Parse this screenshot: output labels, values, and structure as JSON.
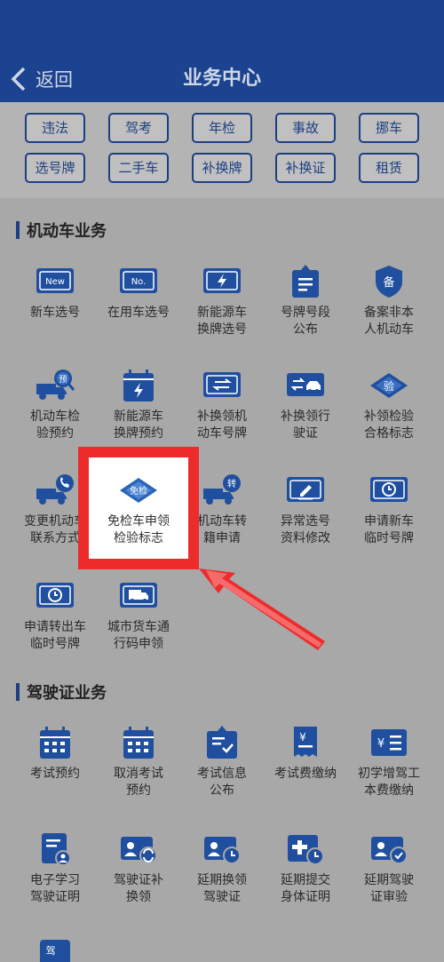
{
  "header": {
    "back_label": "返回",
    "title": "业务中心"
  },
  "quick_links": [
    "违法",
    "驾考",
    "年检",
    "事故",
    "挪车",
    "选号牌",
    "二手车",
    "补换牌",
    "补换证",
    "租赁"
  ],
  "sections": {
    "vehicle": {
      "title": "机动车业务",
      "items": [
        {
          "label": "新车选号",
          "icon": "plate-new-icon"
        },
        {
          "label": "在用车选号",
          "icon": "plate-no-icon"
        },
        {
          "label": "新能源车\n换牌选号",
          "icon": "ev-plate-icon"
        },
        {
          "label": "号牌号段\n公布",
          "icon": "announce-icon"
        },
        {
          "label": "备案非本\n人机动车",
          "icon": "shield-icon"
        },
        {
          "label": "机动车检\n验预约",
          "icon": "truck-search-icon"
        },
        {
          "label": "新能源车\n换牌预约",
          "icon": "calendar-ev-icon"
        },
        {
          "label": "补换领机\n动车号牌",
          "icon": "plate-swap-icon"
        },
        {
          "label": "补换领行\n驶证",
          "icon": "license-swap-icon"
        },
        {
          "label": "补领检验\n合格标志",
          "icon": "diamond-icon"
        },
        {
          "label": "变更机动车\n联系方式",
          "icon": "truck-phone-icon"
        },
        {
          "label": "免检车申领\n检验标志",
          "icon": "exempt-diamond-icon"
        },
        {
          "label": "机动车转\n籍申请",
          "icon": "truck-transfer-icon"
        },
        {
          "label": "异常选号\n资料修改",
          "icon": "edit-plate-icon"
        },
        {
          "label": "申请新车\n临时号牌",
          "icon": "temp-plate-icon"
        },
        {
          "label": "申请转出车\n临时号牌",
          "icon": "temp-plate-out-icon"
        },
        {
          "label": "城市货车通\n行码申领",
          "icon": "truck-pass-icon"
        }
      ],
      "badges": {
        "plate_new": "New",
        "plate_no": "No.",
        "diamond": "验",
        "exempt": "免检",
        "transfer": "转",
        "shield": "备",
        "review": "预"
      }
    },
    "driver": {
      "title": "驾驶证业务",
      "items": [
        {
          "label": "考试预约",
          "icon": "calendar-icon"
        },
        {
          "label": "取消考试\n预约",
          "icon": "calendar-cancel-icon"
        },
        {
          "label": "考试信息\n公布",
          "icon": "info-board-icon"
        },
        {
          "label": "考试费缴纳",
          "icon": "fee-icon"
        },
        {
          "label": "初学增驾工\n本费缴纳",
          "icon": "fee-list-icon"
        },
        {
          "label": "电子学习\n驾驶证明",
          "icon": "doc-user-icon"
        },
        {
          "label": "驾驶证补\n换领",
          "icon": "card-swap-icon"
        },
        {
          "label": "延期换领\n驾驶证",
          "icon": "card-clock-icon"
        },
        {
          "label": "延期提交\n身体证明",
          "icon": "medical-clock-icon"
        },
        {
          "label": "延期驾驶\n证审验",
          "icon": "card-check-icon"
        }
      ],
      "badges": {
        "drive": "驾"
      }
    }
  },
  "colors": {
    "header_bg": "#1c4390",
    "icon_blue": "#1f4f9e",
    "highlight": "#ee2b2b",
    "arrow": "#ee2b2b"
  }
}
